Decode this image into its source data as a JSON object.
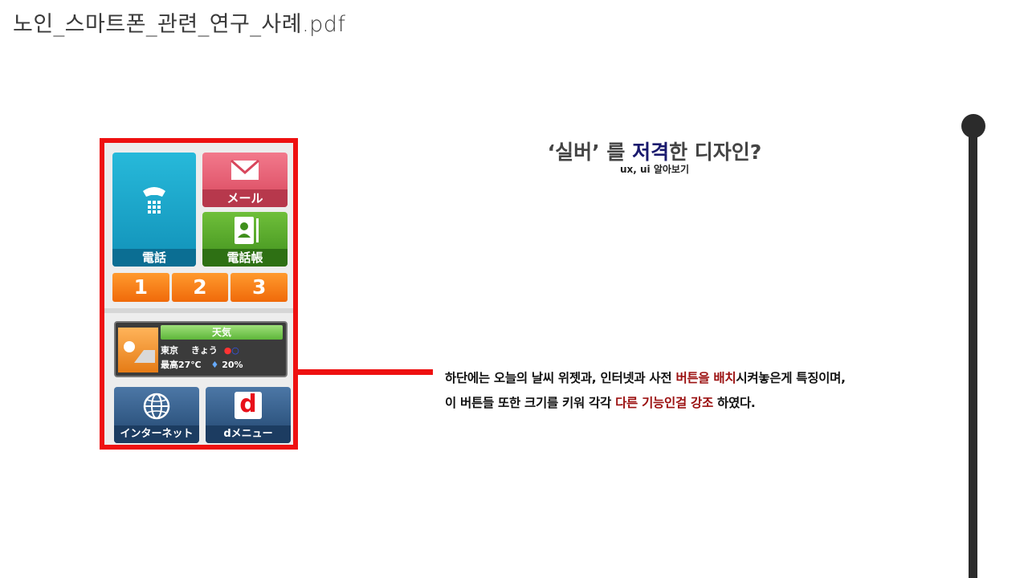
{
  "file_title": "노인_스마트폰_관련_연구_사례.pdf",
  "heading": {
    "part1": "‘실버’ 를 ",
    "highlight": "저격",
    "part2": "한 디자인?",
    "sub": "ux, ui 알아보기"
  },
  "phone": {
    "tiles": {
      "phone_label": "電話",
      "mail_label": "メール",
      "book_label": "電話帳",
      "internet_label": "インターネット",
      "dmenu_label": "dメニュー",
      "dmenu_icon_letter": "d"
    },
    "numbers": [
      "1",
      "2",
      "3"
    ],
    "weather": {
      "header": "天気",
      "line1_city": "東京",
      "line1_day": "きょう",
      "line2_temp": "最高27℃",
      "line2_rain": "20%"
    }
  },
  "description": {
    "l1a": "하단에는 오늘의 날씨 위젯과, 인터넷과 사전 ",
    "l1b": "버튼을 배치",
    "l1c": "시켜놓은게 특징이며,",
    "l2a": "이 버튼들 또한 크기를 키워 각각 ",
    "l2b": "다른 기능인걸 강조",
    "l2c": " 하였다."
  },
  "colors": {
    "frame_red": "#ee1111",
    "highlight_navy": "#1a1a6e",
    "emphasis_red": "#9b1010",
    "timeline": "#2b2b2b"
  }
}
